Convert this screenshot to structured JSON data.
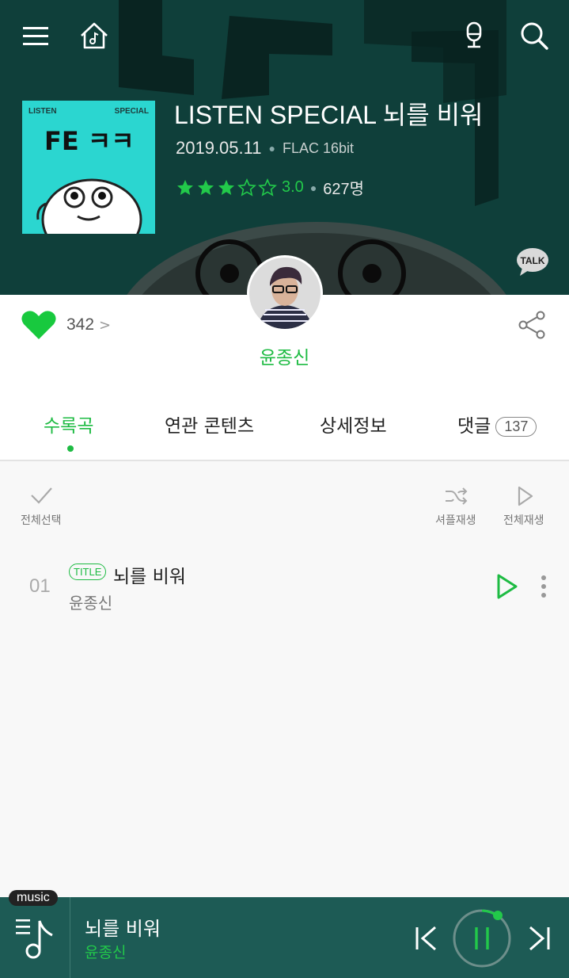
{
  "header": {
    "album_title": "LISTEN SPECIAL 뇌를 비워",
    "release_date": "2019.05.11",
    "format": "FLAC 16bit",
    "rating_value": "3.0",
    "rating_count": "627명",
    "rating_stars_filled": 3,
    "rating_stars_total": 5,
    "cover": {
      "top_left_text": "LISTEN",
      "top_right_text": "SPECIAL",
      "art_text": "FE ㅋㅋ"
    },
    "icons": {
      "menu": "menu-icon",
      "home": "home-music-icon",
      "voice": "microphone-icon",
      "search": "search-icon",
      "talk": "kakao-talk-icon"
    },
    "talk_label": "TALK"
  },
  "artist_row": {
    "like_count": "342",
    "like_arrow": ">",
    "artist_name": "윤종신"
  },
  "tabs": [
    {
      "label": "수록곡",
      "active": true
    },
    {
      "label": "연관 콘텐츠",
      "active": false
    },
    {
      "label": "상세정보",
      "active": false
    },
    {
      "label": "댓글",
      "active": false,
      "badge": "137"
    }
  ],
  "controls": {
    "select_all": "전체선택",
    "shuffle_play": "셔플재생",
    "play_all": "전체재생"
  },
  "tracks": [
    {
      "number": "01",
      "badge": "TITLE",
      "title": "뇌를 비워",
      "artist": "윤종신"
    }
  ],
  "player": {
    "tag": "music",
    "title": "뇌를 비워",
    "artist": "윤종신"
  },
  "colors": {
    "accent_green": "#1ebb43",
    "header_bg": "#0f3f3a",
    "player_bg": "#1d5b55"
  }
}
